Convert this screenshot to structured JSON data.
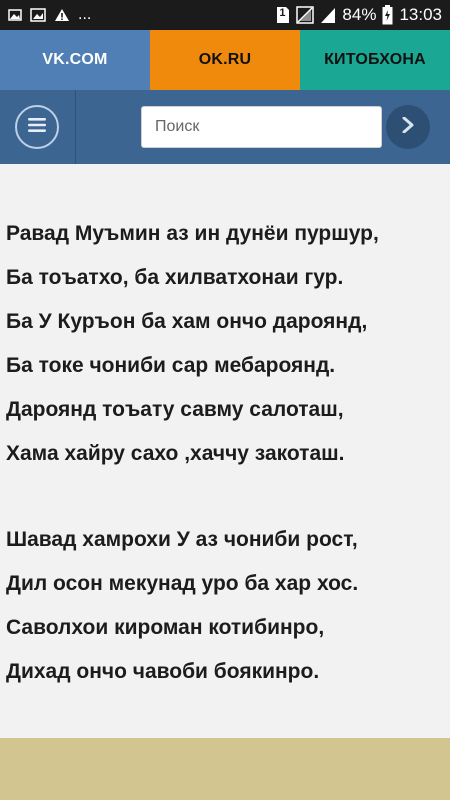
{
  "status_bar": {
    "battery": "84%",
    "time": "13:03",
    "sim_badge": "1",
    "dots": "...",
    "icons": [
      "image-icon",
      "gallery-icon",
      "warning-icon",
      "sim-icon",
      "no-sim-icon",
      "signal-icon",
      "battery-icon"
    ]
  },
  "tabs": [
    {
      "label": "VK.COM",
      "color": "#4f7fb5"
    },
    {
      "label": "OK.RU",
      "color": "#f08a0c"
    },
    {
      "label": "КИТОБХОНА",
      "color": "#1aa894"
    }
  ],
  "search": {
    "placeholder": "Поиск",
    "value": ""
  },
  "poem": {
    "stanza1": [
      "Равад Муъмин аз ин дунёи пуршур,",
      "Ба тоъатхо, ба хилватхонаи гур.",
      "Ба У Куръон ба хам ончо дароянд,",
      "Ба токе чониби сар мебароянд.",
      "Дароянд тоъату савму салоташ,",
      "Хама хайру сахо ,хаччу закоташ."
    ],
    "stanza2": [
      "Шавад хамрохи У аз чониби рост,",
      "Дил осон мекунад уро ба хар хос.",
      "Саволхои кироман котибинро,",
      "Дихад ончо чавоби боякинро."
    ]
  }
}
